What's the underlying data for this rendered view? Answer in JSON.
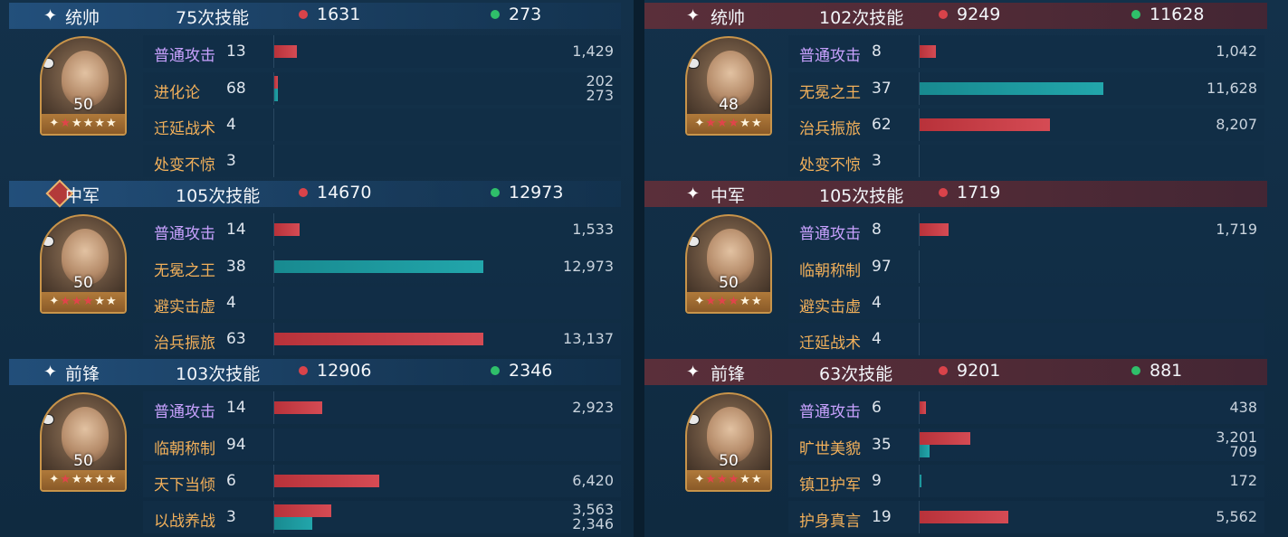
{
  "colors": {
    "damage": "#d9434a",
    "heal": "#2fbf6a",
    "bar_damage": "#c43c45",
    "bar_heal": "#1f9ea3",
    "label_normal": "#c9a2ff",
    "label_skill": "#f2b05a"
  },
  "left": {
    "units": [
      {
        "role": "统帅",
        "count": "75次技能",
        "damage": "1631",
        "heal": "273",
        "icon": "sparkle-icon",
        "level": "50",
        "stars_red": 1,
        "stars_total": 6,
        "skills": [
          {
            "name": "普通攻击",
            "n": "13",
            "type": "normal",
            "dmg_frac": 0.07,
            "heal_frac": 0,
            "v1": "1,429",
            "v2": ""
          },
          {
            "name": "进化论",
            "n": "68",
            "type": "skill",
            "dmg_frac": 0.01,
            "heal_frac": 0.01,
            "v1": "202",
            "v2": "273"
          },
          {
            "name": "迁延战术",
            "n": "4",
            "type": "skill",
            "dmg_frac": 0,
            "heal_frac": 0,
            "v1": "",
            "v2": ""
          },
          {
            "name": "处变不惊",
            "n": "3",
            "type": "skill",
            "dmg_frac": 0,
            "heal_frac": 0,
            "v1": "",
            "v2": ""
          }
        ]
      },
      {
        "role": "中军",
        "count": "105次技能",
        "damage": "14670",
        "heal": "12973",
        "icon": "banner-diamond-icon",
        "level": "50",
        "stars_red": 3,
        "stars_total": 6,
        "skills": [
          {
            "name": "普通攻击",
            "n": "14",
            "type": "normal",
            "dmg_frac": 0.08,
            "heal_frac": 0,
            "v1": "1,533",
            "v2": ""
          },
          {
            "name": "无冕之王",
            "n": "38",
            "type": "skill",
            "dmg_frac": 0,
            "heal_frac": 0.66,
            "v1": "12,973",
            "v2": ""
          },
          {
            "name": "避实击虚",
            "n": "4",
            "type": "skill",
            "dmg_frac": 0,
            "heal_frac": 0,
            "v1": "",
            "v2": ""
          },
          {
            "name": "治兵振旅",
            "n": "63",
            "type": "skill",
            "dmg_frac": 0.66,
            "heal_frac": 0,
            "v1": "13,137",
            "v2": ""
          }
        ]
      },
      {
        "role": "前锋",
        "count": "103次技能",
        "damage": "12906",
        "heal": "2346",
        "icon": "sparkle-icon",
        "level": "50",
        "stars_red": 1,
        "stars_total": 6,
        "skills": [
          {
            "name": "普通攻击",
            "n": "14",
            "type": "normal",
            "dmg_frac": 0.15,
            "heal_frac": 0,
            "v1": "2,923",
            "v2": ""
          },
          {
            "name": "临朝称制",
            "n": "94",
            "type": "skill",
            "dmg_frac": 0,
            "heal_frac": 0,
            "v1": "",
            "v2": ""
          },
          {
            "name": "天下当倾",
            "n": "6",
            "type": "skill",
            "dmg_frac": 0.33,
            "heal_frac": 0,
            "v1": "6,420",
            "v2": ""
          },
          {
            "name": "以战养战",
            "n": "3",
            "type": "skill",
            "dmg_frac": 0.18,
            "heal_frac": 0.12,
            "v1": "3,563",
            "v2": "2,346"
          }
        ]
      }
    ]
  },
  "right": {
    "units": [
      {
        "role": "统帅",
        "count": "102次技能",
        "damage": "9249",
        "heal": "11628",
        "icon": "sparkle-icon",
        "level": "48",
        "stars_red": 3,
        "stars_total": 6,
        "skills": [
          {
            "name": "普通攻击",
            "n": "8",
            "type": "normal",
            "dmg_frac": 0.05,
            "heal_frac": 0,
            "v1": "1,042",
            "v2": ""
          },
          {
            "name": "无冕之王",
            "n": "37",
            "type": "skill",
            "dmg_frac": 0,
            "heal_frac": 0.58,
            "v1": "11,628",
            "v2": ""
          },
          {
            "name": "治兵振旅",
            "n": "62",
            "type": "skill",
            "dmg_frac": 0.41,
            "heal_frac": 0,
            "v1": "8,207",
            "v2": ""
          },
          {
            "name": "处变不惊",
            "n": "3",
            "type": "skill",
            "dmg_frac": 0,
            "heal_frac": 0,
            "v1": "",
            "v2": ""
          }
        ]
      },
      {
        "role": "中军",
        "count": "105次技能",
        "damage": "1719",
        "heal": "",
        "icon": "sparkle-icon",
        "level": "50",
        "stars_red": 3,
        "stars_total": 6,
        "skills": [
          {
            "name": "普通攻击",
            "n": "8",
            "type": "normal",
            "dmg_frac": 0.09,
            "heal_frac": 0,
            "v1": "1,719",
            "v2": ""
          },
          {
            "name": "临朝称制",
            "n": "97",
            "type": "skill",
            "dmg_frac": 0,
            "heal_frac": 0,
            "v1": "",
            "v2": ""
          },
          {
            "name": "避实击虚",
            "n": "4",
            "type": "skill",
            "dmg_frac": 0,
            "heal_frac": 0,
            "v1": "",
            "v2": ""
          },
          {
            "name": "迁延战术",
            "n": "4",
            "type": "skill",
            "dmg_frac": 0,
            "heal_frac": 0,
            "v1": "",
            "v2": ""
          }
        ]
      },
      {
        "role": "前锋",
        "count": "63次技能",
        "damage": "9201",
        "heal": "881",
        "icon": "sparkle-icon",
        "level": "50",
        "stars_red": 3,
        "stars_total": 6,
        "skills": [
          {
            "name": "普通攻击",
            "n": "6",
            "type": "normal",
            "dmg_frac": 0.02,
            "heal_frac": 0,
            "v1": "438",
            "v2": ""
          },
          {
            "name": "旷世美貌",
            "n": "35",
            "type": "skill",
            "dmg_frac": 0.16,
            "heal_frac": 0.03,
            "v1": "3,201",
            "v2": "709"
          },
          {
            "name": "镇卫护军",
            "n": "9",
            "type": "skill",
            "dmg_frac": 0,
            "heal_frac": 0.005,
            "v1": "172",
            "v2": ""
          },
          {
            "name": "护身真言",
            "n": "19",
            "type": "skill",
            "dmg_frac": 0.28,
            "heal_frac": 0,
            "v1": "5,562",
            "v2": ""
          }
        ]
      }
    ]
  }
}
